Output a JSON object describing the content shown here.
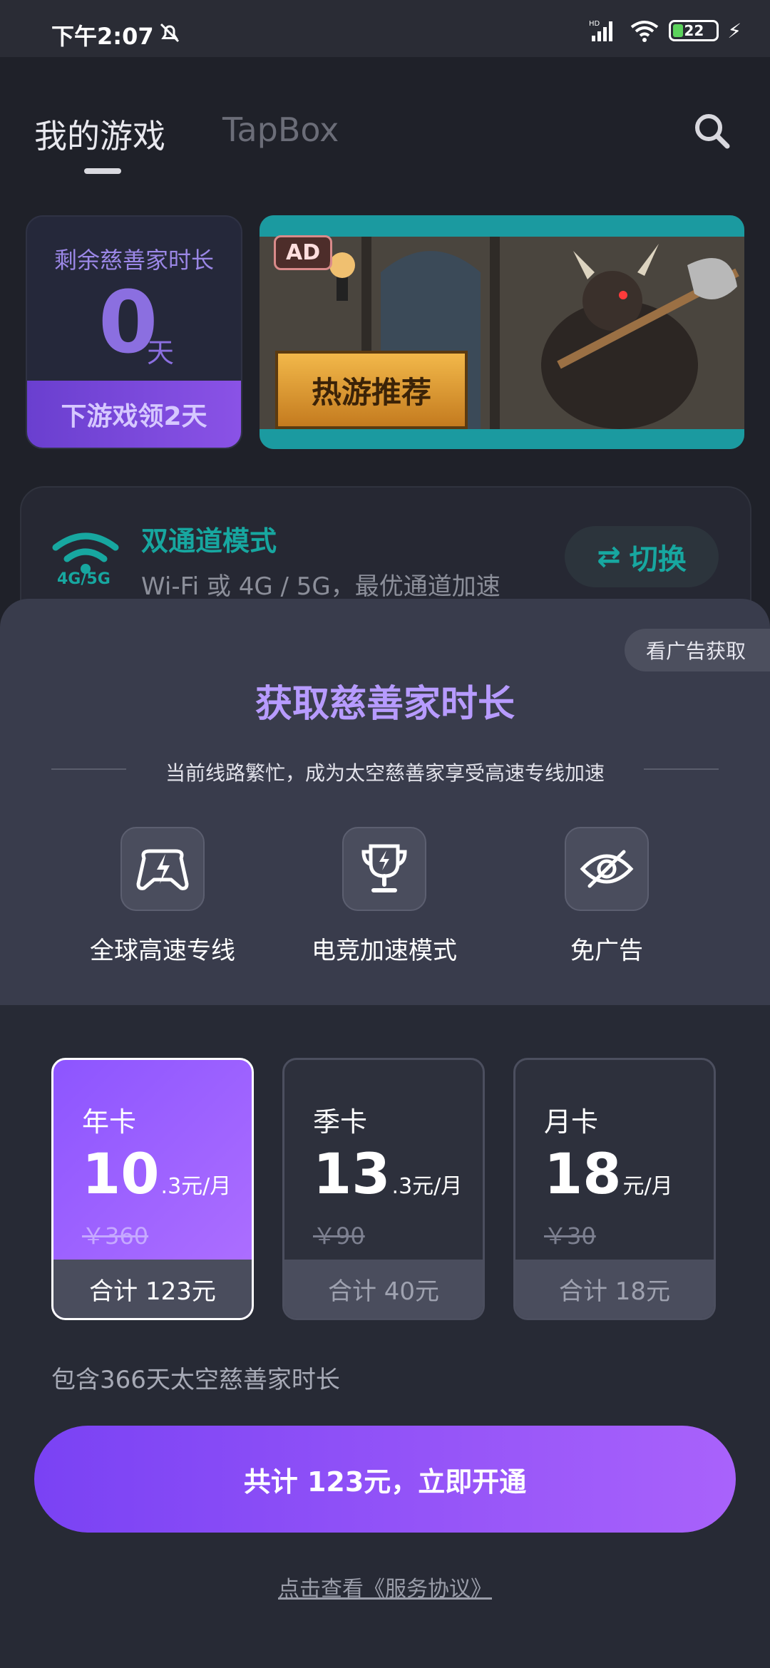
{
  "status_bar": {
    "time": "下午2:07",
    "battery": "22",
    "network": "HD"
  },
  "header": {
    "tabs": [
      "我的游戏",
      "TapBox"
    ]
  },
  "charity_card": {
    "title": "剩余慈善家时长",
    "days": "0",
    "unit": "天",
    "action": "下游戏领2天"
  },
  "banner": {
    "ad_label": "AD",
    "title": "热游推荐"
  },
  "mode": {
    "tag": "4G/5G",
    "title": "双通道模式",
    "desc": "Wi-Fi 或 4G / 5G，最优通道加速",
    "switch_label": "切换"
  },
  "sheet": {
    "ad_pill": "看广告获取",
    "title": "获取慈善家时长",
    "subtitle": "当前线路繁忙，成为太空慈善家享受高速专线加速",
    "features": [
      "全球高速专线",
      "电竞加速模式",
      "免广告"
    ]
  },
  "plans": [
    {
      "name": "年卡",
      "price_big": "10",
      "price_small": ".3元/月",
      "original": "￥360",
      "total": "合计 123元",
      "selected": true
    },
    {
      "name": "季卡",
      "price_big": "13",
      "price_small": ".3元/月",
      "original": "￥90",
      "total": "合计 40元",
      "selected": false
    },
    {
      "name": "月卡",
      "price_big": "18",
      "price_small": "元/月",
      "original": "￥30",
      "total": "合计 18元",
      "selected": false
    }
  ],
  "include_note": "包含366天太空慈善家时长",
  "cta_label": "共计 123元，立即开通",
  "terms_link": "点击查看《服务协议》",
  "colors": {
    "accent": "#8b5cf6",
    "teal": "#17a7a0",
    "sheet_bg": "#393c4c"
  }
}
